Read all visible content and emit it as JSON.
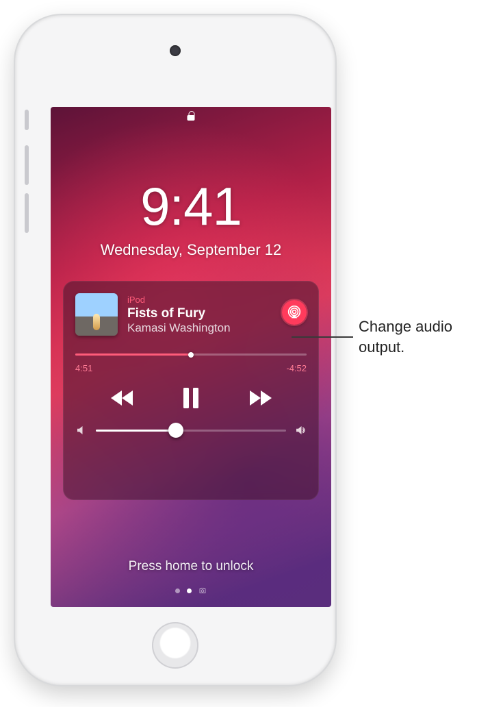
{
  "status": {
    "time": "9:41",
    "date": "Wednesday, September 12"
  },
  "player": {
    "source": "iPod",
    "title": "Fists of Fury",
    "artist": "Kamasi Washington",
    "elapsed": "4:51",
    "remaining": "-4:52",
    "scrub_pct": 50,
    "volume_pct": 42
  },
  "unlock_hint": "Press home to unlock",
  "callout": "Change audio output."
}
